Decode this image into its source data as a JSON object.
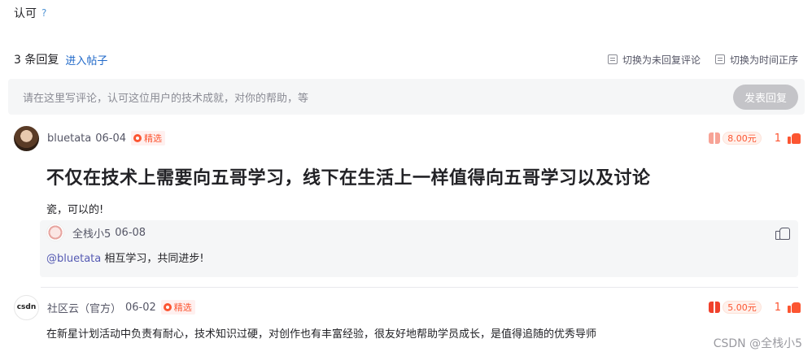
{
  "top": {
    "text": "认可",
    "help": "?"
  },
  "header": {
    "count": "3 条回复",
    "enter_post": "进入帖子",
    "switch_unreplied": "切换为未回复评论",
    "switch_time": "切换为时间正序"
  },
  "input": {
    "placeholder": "请在这里写评论，认可这位用户的技术成就，对你的帮助，等",
    "submit": "发表回复"
  },
  "comments": [
    {
      "user": "bluetata",
      "date": "06-04",
      "badge": "精选",
      "reward": "8.00元",
      "likes": "1",
      "title": "不仅在技术上需要向五哥学习，线下在生活上一样值得向五哥学习以及讨论",
      "body": "瓷，可以的!",
      "reply": {
        "user": "全栈小5",
        "date": "06-08",
        "mention": "@bluetata",
        "body": " 相互学习，共同进步!"
      }
    },
    {
      "user": "社区云（官方）",
      "date": "06-02",
      "badge": "精选",
      "reward": "5.00元",
      "likes": "1",
      "avatar_text": "csdn",
      "body": "在新星计划活动中负责有耐心，技术知识过硬，对创作也有丰富经验，很友好地帮助学员成长，是值得追随的优秀导师"
    }
  ],
  "watermark": "CSDN @全栈小5",
  "colors": {
    "accent": "#fc5531",
    "link": "#2069c9",
    "mention": "#555ab3"
  },
  "icons": [
    "question-icon",
    "list-toggle-icon",
    "featured-icon",
    "reward-gift-icon",
    "thumb-up-icon",
    "thumb-up-outline-icon"
  ]
}
